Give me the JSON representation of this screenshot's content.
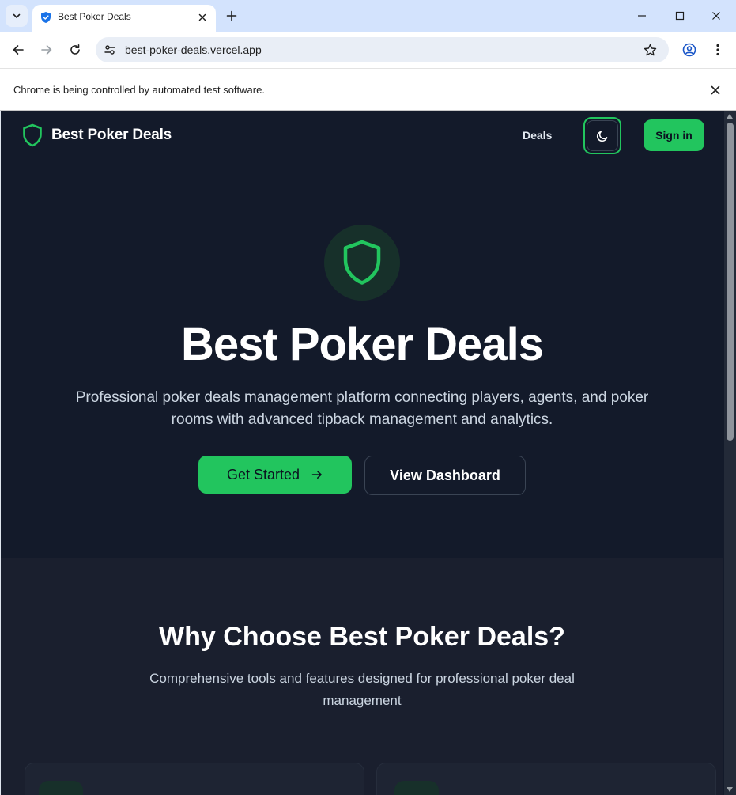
{
  "browser": {
    "tab_title": "Best Poker Deals",
    "url": "best-poker-deals.vercel.app",
    "infobar_text": "Chrome is being controlled by automated test software."
  },
  "site": {
    "brand_name": "Best Poker Deals",
    "nav": {
      "deals_label": "Deals",
      "signin_label": "Sign in"
    }
  },
  "hero": {
    "title": "Best Poker Deals",
    "subtitle": "Professional poker deals management platform connecting players, agents, and poker rooms with advanced tipback management and analytics.",
    "primary_button": "Get Started",
    "secondary_button": "View Dashboard"
  },
  "features": {
    "title": "Why Choose Best Poker Deals?",
    "subtitle": "Comprehensive tools and features designed for professional poker deal management"
  },
  "colors": {
    "accent": "#22c55e",
    "page_bg": "#131a2a",
    "section_bg": "#1a1f2e"
  },
  "icons": [
    "chevron-down-icon",
    "shield-icon",
    "close-icon",
    "plus-icon",
    "minimize-icon",
    "maximize-icon",
    "back-icon",
    "forward-icon",
    "reload-icon",
    "site-info-icon",
    "star-icon",
    "profile-icon",
    "more-icon",
    "moon-icon",
    "arrow-right-icon"
  ]
}
